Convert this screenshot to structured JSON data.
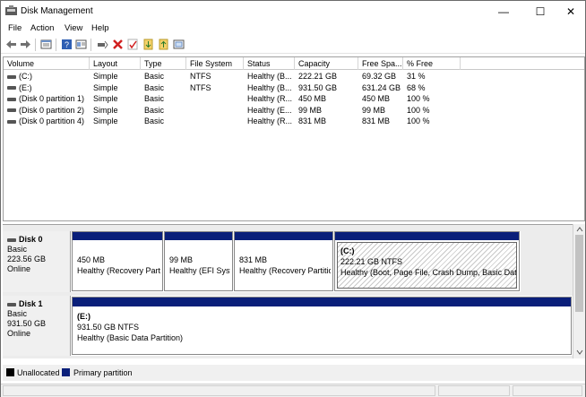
{
  "window": {
    "title": "Disk Management",
    "minimize": "—",
    "maximize": "☐",
    "close": "✕"
  },
  "menu": [
    "File",
    "Action",
    "View",
    "Help"
  ],
  "toolbar_icons": [
    "back-icon",
    "forward-icon",
    "disk-list-icon",
    "help-icon",
    "properties-icon",
    "connect-icon",
    "delete-icon",
    "check-icon",
    "import-icon",
    "export-icon",
    "refresh-icon"
  ],
  "columns": [
    "Volume",
    "Layout",
    "Type",
    "File System",
    "Status",
    "Capacity",
    "Free Spa...",
    "% Free"
  ],
  "volumes": [
    {
      "volume": "(C:)",
      "layout": "Simple",
      "type": "Basic",
      "fs": "NTFS",
      "status": "Healthy (B...",
      "capacity": "222.21 GB",
      "free": "69.32 GB",
      "pct": "31 %"
    },
    {
      "volume": "(E:)",
      "layout": "Simple",
      "type": "Basic",
      "fs": "NTFS",
      "status": "Healthy (B...",
      "capacity": "931.50 GB",
      "free": "631.24 GB",
      "pct": "68 %"
    },
    {
      "volume": "(Disk 0 partition 1)",
      "layout": "Simple",
      "type": "Basic",
      "fs": "",
      "status": "Healthy (R...",
      "capacity": "450 MB",
      "free": "450 MB",
      "pct": "100 %"
    },
    {
      "volume": "(Disk 0 partition 2)",
      "layout": "Simple",
      "type": "Basic",
      "fs": "",
      "status": "Healthy (E...",
      "capacity": "99 MB",
      "free": "99 MB",
      "pct": "100 %"
    },
    {
      "volume": "(Disk 0 partition 4)",
      "layout": "Simple",
      "type": "Basic",
      "fs": "",
      "status": "Healthy (R...",
      "capacity": "831 MB",
      "free": "831 MB",
      "pct": "100 %"
    }
  ],
  "disks": [
    {
      "name": "Disk 0",
      "type": "Basic",
      "size": "223.56 GB",
      "state": "Online",
      "partitions": [
        {
          "title": "",
          "line1": "450 MB",
          "line2": "Healthy (Recovery Parti"
        },
        {
          "title": "",
          "line1": "99 MB",
          "line2": "Healthy (EFI Syst"
        },
        {
          "title": "",
          "line1": "831 MB",
          "line2": "Healthy (Recovery Partitio"
        },
        {
          "title": "(C:)",
          "line1": "222.21 GB NTFS",
          "line2": "Healthy (Boot, Page File, Crash Dump, Basic Data P"
        }
      ]
    },
    {
      "name": "Disk 1",
      "type": "Basic",
      "size": "931.50 GB",
      "state": "Online",
      "partitions": [
        {
          "title": "(E:)",
          "line1": "931.50 GB NTFS",
          "line2": "Healthy (Basic Data Partition)"
        }
      ]
    }
  ],
  "legend": [
    {
      "label": "Unallocated",
      "color": "#000000"
    },
    {
      "label": "Primary partition",
      "color": "#0a1f7a"
    }
  ]
}
